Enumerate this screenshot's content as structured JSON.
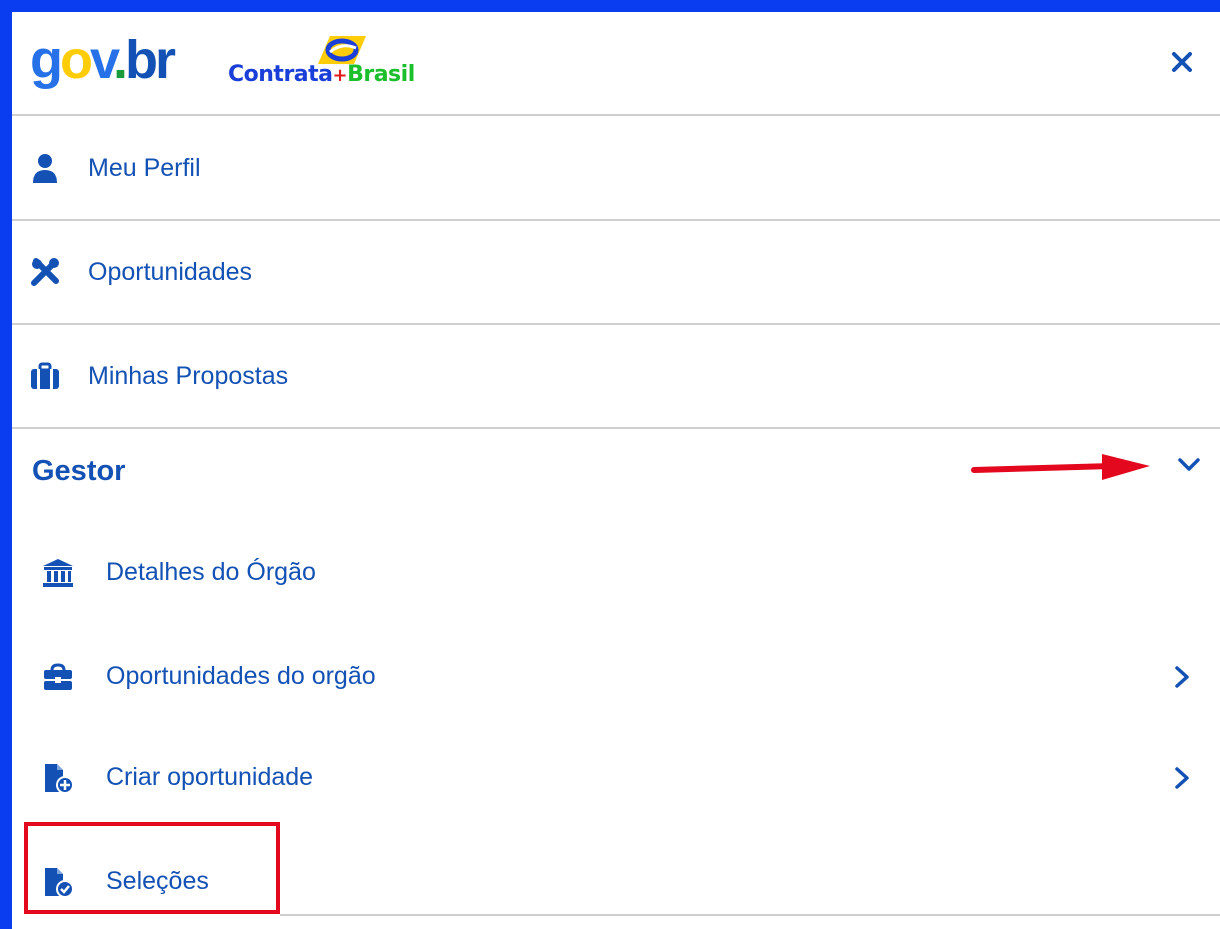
{
  "header": {
    "govbr_logo": {
      "g": "g",
      "o": "o",
      "v": "v",
      "dot": ".",
      "br": "br"
    },
    "contrata_logo": {
      "part1": "Contrata",
      "plus": "+",
      "part2": "Brasil"
    },
    "close_label": "×"
  },
  "menu": {
    "items": [
      {
        "label": "Meu Perfil",
        "icon": "user-icon"
      },
      {
        "label": "Oportunidades",
        "icon": "tools-icon"
      },
      {
        "label": "Minhas Propostas",
        "icon": "briefcase-icon"
      }
    ]
  },
  "gestor": {
    "title": "Gestor",
    "expanded": true,
    "items": [
      {
        "label": "Detalhes do Órgão",
        "icon": "building-icon",
        "has_submenu": false
      },
      {
        "label": "Oportunidades do orgão",
        "icon": "toolbox-icon",
        "has_submenu": true
      },
      {
        "label": "Criar oportunidade",
        "icon": "file-add-icon",
        "has_submenu": true
      },
      {
        "label": "Seleções",
        "icon": "file-check-icon",
        "has_submenu": false
      }
    ]
  },
  "colors": {
    "primary": "#1351b4",
    "frame_border": "#0a3df0",
    "annotation_red": "#e3081d"
  }
}
